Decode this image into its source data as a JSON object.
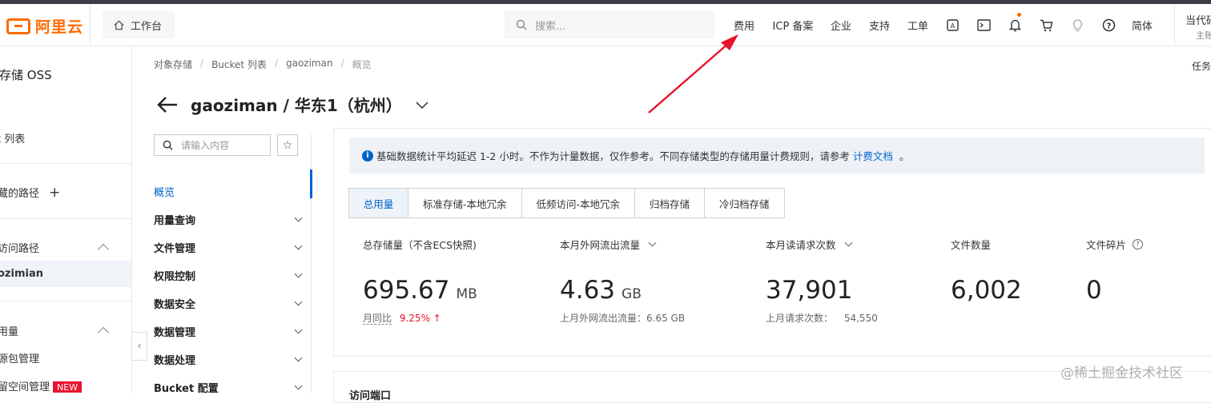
{
  "header": {
    "logo_text": "阿里云",
    "home_label": "工作台",
    "search_placeholder": "搜索...",
    "nav": [
      "费用",
      "ICP 备案",
      "企业",
      "支持",
      "工单"
    ],
    "icons": [
      "app-icon",
      "terminal-icon",
      "bell-icon",
      "cart-icon",
      "lightbulb-icon",
      "help-icon"
    ],
    "lang": "简体",
    "user_name": "当代研",
    "user_role": "主账"
  },
  "leftnav": {
    "title": "存储 OSS",
    "bucket_list": "t 列表",
    "my_paths": "藏的路径",
    "recent_paths": "访问路径",
    "active_bucket": "ozimian",
    "usage": "用量",
    "package": "源包管理",
    "reserved": "留空间管理",
    "new_badge": "NEW"
  },
  "breadcrumb": [
    "对象存储",
    "Bucket 列表",
    "gaoziman",
    "概览"
  ],
  "task_label": "任务",
  "page_title": "gaoziman / 华东1（杭州）",
  "submenu": {
    "search_placeholder": "请输入内容",
    "items": [
      "概览",
      "用量查询",
      "文件管理",
      "权限控制",
      "数据安全",
      "数据管理",
      "数据处理",
      "Bucket 配置"
    ]
  },
  "notice": {
    "text": "基础数据统计平均延迟 1-2 小时。不作为计量数据，仅作参考。不同存储类型的存储用量计费规则，请参考",
    "link": "计费文档",
    "tail": "。"
  },
  "tabs": [
    "总用量",
    "标准存储-本地冗余",
    "低频访问-本地冗余",
    "归档存储",
    "冷归档存储"
  ],
  "metrics": {
    "storage": {
      "label": "总存储量（不含ECS快照)",
      "value": "695.67",
      "unit": "MB",
      "sub_label": "月同比",
      "sub_value": "9.25%",
      "sub_arrow": "↑"
    },
    "traffic": {
      "label": "本月外网流出流量",
      "value": "4.63",
      "unit": "GB",
      "sub": "上月外网流出流量：6.65 GB"
    },
    "requests": {
      "label": "本月读请求次数",
      "value": "37,901",
      "sub_label": "上月请求次数：",
      "sub_value": "54,550"
    },
    "files": {
      "label": "文件数量",
      "value": "6,002"
    },
    "fragments": {
      "label": "文件碎片",
      "value": "0"
    }
  },
  "bottom_peek": "访问端口",
  "watermark": "@稀土掘金技术社区",
  "colors": {
    "brand": "#ff6a00",
    "link": "#0064c8",
    "annotation_arrow": "#e8132c"
  }
}
